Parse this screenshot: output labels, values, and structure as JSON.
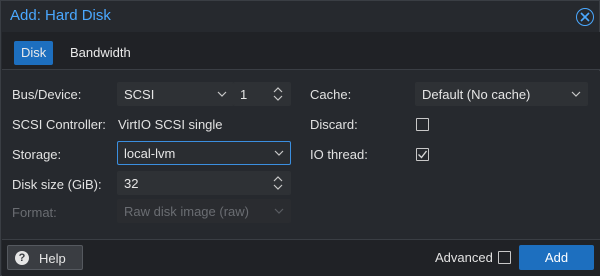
{
  "dialog": {
    "title": "Add: Hard Disk",
    "close_icon": "close-circle-icon"
  },
  "tabs": [
    {
      "label": "Disk",
      "active": true
    },
    {
      "label": "Bandwidth",
      "active": false
    }
  ],
  "form": {
    "bus_device": {
      "label": "Bus/Device:",
      "bus_value": "SCSI",
      "device_value": "1"
    },
    "scsi_controller": {
      "label": "SCSI Controller:",
      "value": "VirtIO SCSI single"
    },
    "storage": {
      "label": "Storage:",
      "value": "local-lvm"
    },
    "disk_size": {
      "label": "Disk size (GiB):",
      "value": "32"
    },
    "format": {
      "label": "Format:",
      "value": "Raw disk image (raw)",
      "disabled": true
    },
    "cache": {
      "label": "Cache:",
      "value": "Default (No cache)"
    },
    "discard": {
      "label": "Discard:",
      "checked": false
    },
    "io_thread": {
      "label": "IO thread:",
      "checked": true
    }
  },
  "footer": {
    "help_label": "Help",
    "advanced_label": "Advanced",
    "advanced_checked": false,
    "add_label": "Add"
  },
  "colors": {
    "accent": "#1d6fbf",
    "title": "#4aa8ff",
    "background": "#26292e"
  }
}
